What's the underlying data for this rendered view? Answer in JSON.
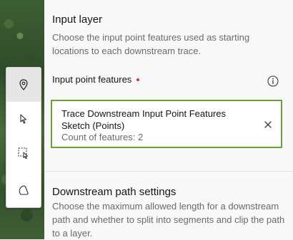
{
  "toolbar": {
    "tools": [
      {
        "icon": "map-pin-icon",
        "selected": true
      },
      {
        "icon": "cursor-arrow-icon",
        "selected": false
      },
      {
        "icon": "rectangle-select-icon",
        "selected": false
      },
      {
        "icon": "lasso-select-icon",
        "selected": false
      }
    ]
  },
  "input_layer": {
    "title": "Input layer",
    "description": "Choose the input point features used as starting locations to each downstream trace.",
    "field_label": "Input point features",
    "required": true,
    "info_icon": "info-icon",
    "selected_feature": {
      "name": "Trace Downstream Input Point Features Sketch (Points)",
      "count_text": "Count of features: 2",
      "remove_icon": "close-icon"
    }
  },
  "downstream_settings": {
    "title": "Downstream path settings",
    "description": "Choose the maximum allowed length for a downstream path and whether to split into segments and clip the path to a layer."
  },
  "colors": {
    "accent_border": "#6aa038",
    "required_dot": "#d83020",
    "text_primary": "#151515",
    "text_secondary": "#6a6a6a"
  }
}
